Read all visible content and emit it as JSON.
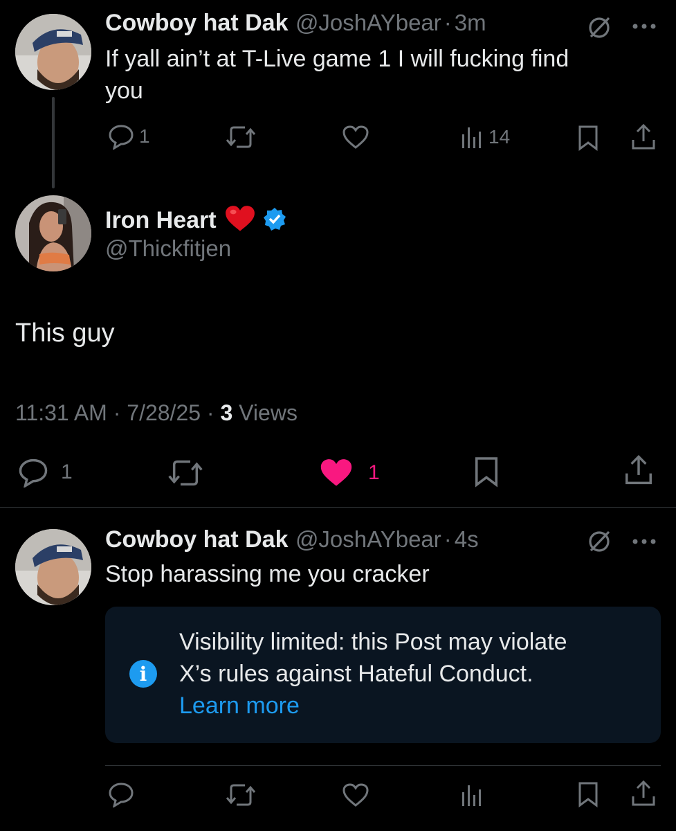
{
  "tweet1": {
    "name": "Cowboy hat Dak",
    "handle": "@JoshAYbear",
    "sep": "·",
    "time": "3m",
    "text_line1": "If yall ain’t at T-Live game 1 I will fucking find",
    "text_line2": "you",
    "reply_count": "1",
    "views_count": "14"
  },
  "main_tweet": {
    "name": "Iron Heart",
    "emoji": "❤️",
    "handle": "@Thickfitjen",
    "text": "This guy",
    "time": "11:31 AM",
    "date": "7/28/25",
    "views_number": "3",
    "views_label": "Views",
    "reply_count": "1",
    "like_count": "1"
  },
  "tweet2": {
    "name": "Cowboy hat Dak",
    "handle": "@JoshAYbear",
    "sep": "·",
    "time": "4s",
    "text": "Stop harassing me you cracker",
    "notice_line1": "Visibility limited: this Post may violate",
    "notice_line2": "X’s rules against Hateful Conduct.",
    "notice_link": "Learn more"
  },
  "colors": {
    "like": "#f91880",
    "link": "#1d9bf0",
    "verified": "#1d9bf0"
  }
}
